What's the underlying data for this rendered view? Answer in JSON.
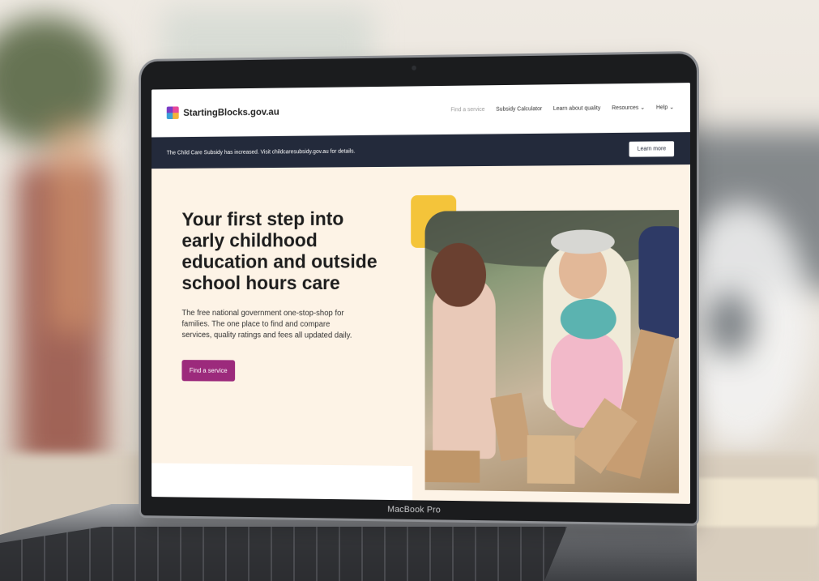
{
  "site": {
    "logo_text": "StartingBlocks.gov.au",
    "nav": [
      {
        "label": "Find a service"
      },
      {
        "label": "Subsidy Calculator"
      },
      {
        "label": "Learn about quality"
      },
      {
        "label": "Resources"
      },
      {
        "label": "Help"
      }
    ]
  },
  "banner": {
    "text": "The Child Care Subsidy has increased. Visit childcaresubsidy.gov.au for details.",
    "button_label": "Learn more"
  },
  "hero": {
    "title": "Your first step into early childhood education and outside school hours care",
    "description": "The free national government one-stop-shop for families. The one place to find and compare services, quality ratings and fees all updated daily.",
    "cta_label": "Find a service"
  },
  "device": {
    "label": "MacBook Pro"
  },
  "colors": {
    "banner_bg": "#232a3b",
    "hero_bg": "#fdf3e6",
    "cta_bg": "#9c2a7c",
    "accent_yellow": "#f4c43a"
  },
  "icons": [
    "logo-mark-icon",
    "chevron-down-icon"
  ]
}
